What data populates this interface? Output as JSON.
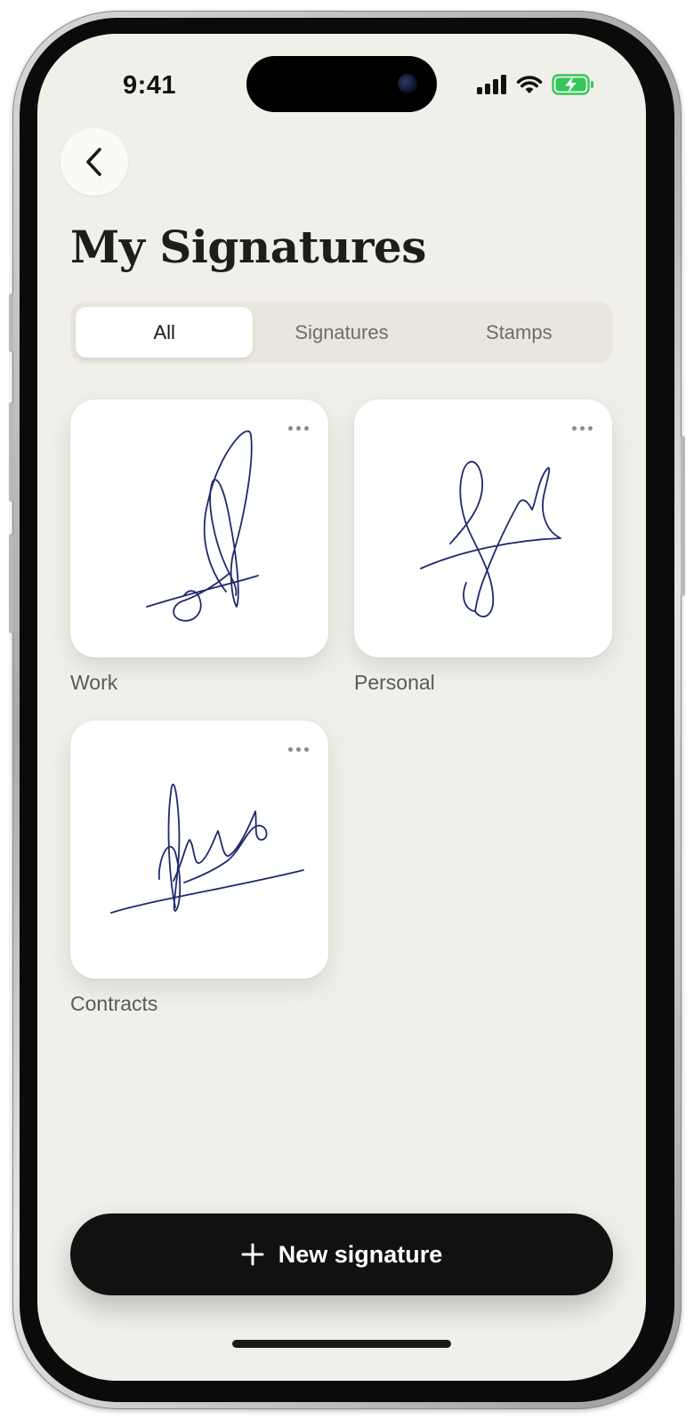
{
  "status_bar": {
    "time": "9:41"
  },
  "header": {
    "title": "My Signatures"
  },
  "tabs": [
    {
      "label": "All",
      "active": true
    },
    {
      "label": "Signatures",
      "active": false
    },
    {
      "label": "Stamps",
      "active": false
    }
  ],
  "cards": [
    {
      "label": "Work",
      "icon": "more-horizontal-icon"
    },
    {
      "label": "Personal",
      "icon": "more-horizontal-icon"
    },
    {
      "label": "Contracts",
      "icon": "more-horizontal-icon"
    }
  ],
  "cta": {
    "label": "New signature",
    "icon": "plus-icon"
  },
  "colors": {
    "background": "#f0efea",
    "ink": "#1f2a6e",
    "primary_button": "#111111",
    "segmented_track": "#e9e7dd",
    "battery": "#34c759"
  }
}
